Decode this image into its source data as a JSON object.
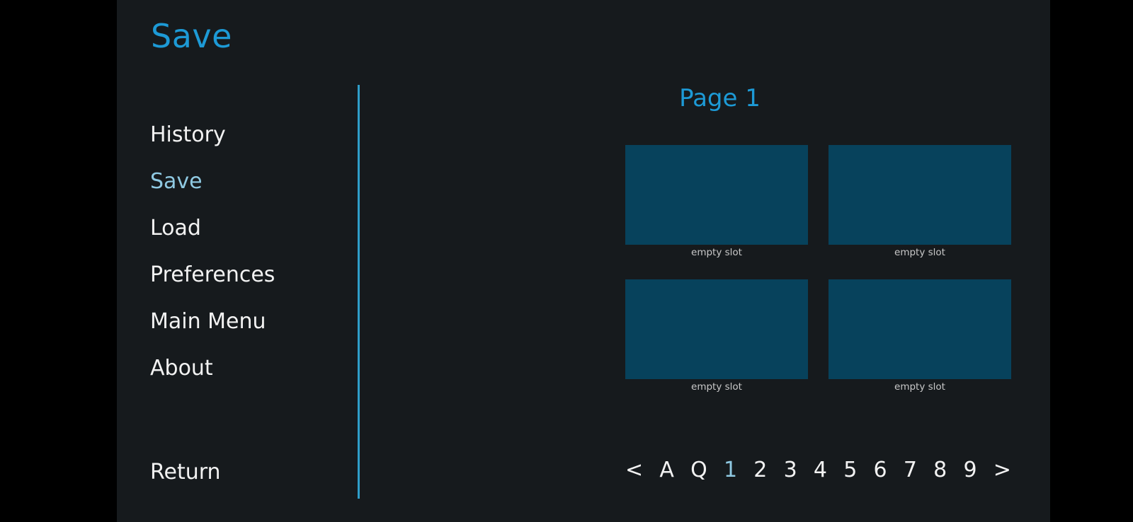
{
  "screen": {
    "letterbox_color": "#000000",
    "panel_background": "#161a1d",
    "accent_color": "#1d9ad6",
    "selected_color": "#8fc9e2",
    "text_color": "#f2f2f2",
    "slot_color": "#07425c",
    "divider_color": "#2f9ec9"
  },
  "header": {
    "title": "Save"
  },
  "sidebar": {
    "items": [
      {
        "label": "History",
        "selected": false
      },
      {
        "label": "Save",
        "selected": true
      },
      {
        "label": "Load",
        "selected": false
      },
      {
        "label": "Preferences",
        "selected": false
      },
      {
        "label": "Main Menu",
        "selected": false
      },
      {
        "label": "About",
        "selected": false
      }
    ],
    "return": {
      "label": "Return"
    }
  },
  "main": {
    "page_label": "Page 1",
    "slots": [
      {
        "caption": "empty slot"
      },
      {
        "caption": "empty slot"
      },
      {
        "caption": "empty slot"
      },
      {
        "caption": "empty slot"
      }
    ]
  },
  "pagination": {
    "previous": "<",
    "next": ">",
    "auto": "A",
    "quick": "Q",
    "pages": [
      "1",
      "2",
      "3",
      "4",
      "5",
      "6",
      "7",
      "8",
      "9"
    ],
    "current_page": "1"
  }
}
